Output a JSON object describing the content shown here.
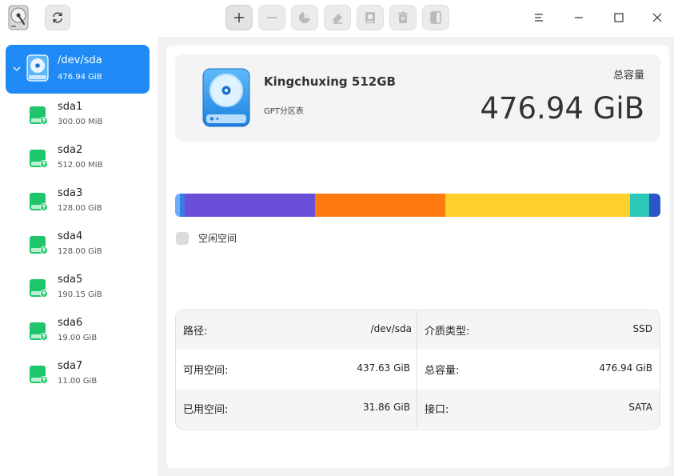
{
  "toolbar": {
    "buttons": [
      "add-partition",
      "delete-partition",
      "partition",
      "wipe",
      "mount",
      "unmount",
      "resize"
    ]
  },
  "sidebar": {
    "disk": {
      "name": "/dev/sda",
      "size": "476.94 GiB"
    },
    "partitions": [
      {
        "name": "sda1",
        "size": "300.00 MiB"
      },
      {
        "name": "sda2",
        "size": "512.00 MiB"
      },
      {
        "name": "sda3",
        "size": "128.00 GiB"
      },
      {
        "name": "sda4",
        "size": "128.00 GiB"
      },
      {
        "name": "sda5",
        "size": "190.15 GiB"
      },
      {
        "name": "sda6",
        "size": "19.00 GiB"
      },
      {
        "name": "sda7",
        "size": "11.00 GiB"
      }
    ]
  },
  "main": {
    "model": "Kingchuxing 512GB",
    "partition_table": "GPT分区表",
    "capacity_label": "总容量",
    "capacity_value": "476.94 GiB",
    "legend_free": "空闲空间",
    "usage_segments": [
      {
        "size_gib": 0.29,
        "color": "#6ab0f5"
      },
      {
        "size_gib": 0.5,
        "color": "#3a7be8"
      },
      {
        "size_gib": 128.0,
        "color": "#6a4fd8"
      },
      {
        "size_gib": 128.0,
        "color": "#ff7b0f"
      },
      {
        "size_gib": 190.15,
        "color": "#ffcf2a"
      },
      {
        "size_gib": 19.0,
        "color": "#2bc8b8"
      },
      {
        "size_gib": 11.0,
        "color": "#2a56c8"
      }
    ],
    "props": {
      "path_label": "路径:",
      "path_value": "/dev/sda",
      "media_label": "介质类型:",
      "media_value": "SSD",
      "free_label": "可用空间:",
      "free_value": "437.63 GiB",
      "total_label": "总容量:",
      "total_value": "476.94 GiB",
      "used_label": "已用空间:",
      "used_value": "31.86 GiB",
      "iface_label": "接口:",
      "iface_value": "SATA"
    }
  },
  "colors": {
    "accent": "#1f8af5",
    "partition_icon": "#1fc56b"
  }
}
